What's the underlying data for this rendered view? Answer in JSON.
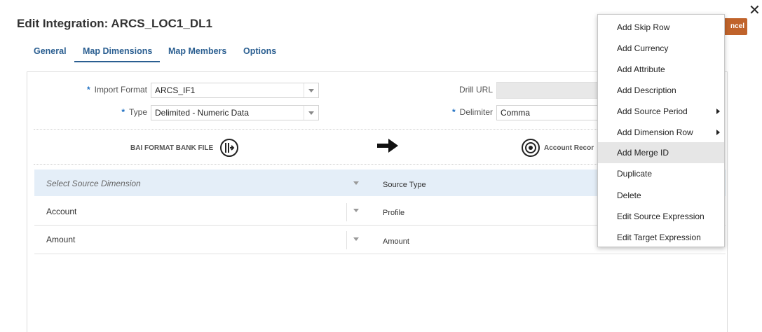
{
  "header": {
    "title": "Edit Integration: ARCS_LOC1_DL1",
    "close_symbol": "✕",
    "cancel_label": "ncel"
  },
  "tabs": [
    {
      "label": "General"
    },
    {
      "label": "Map Dimensions",
      "active": true
    },
    {
      "label": "Map Members"
    },
    {
      "label": "Options"
    }
  ],
  "form": {
    "required_mark": "*",
    "import_format_label": "Import Format",
    "import_format_value": "ARCS_IF1",
    "type_label": "Type",
    "type_value": "Delimited - Numeric Data",
    "drill_url_label": "Drill URL",
    "drill_url_value": "",
    "delimiter_label": "Delimiter",
    "delimiter_value": "Comma"
  },
  "flow": {
    "source_label": "BAI FORMAT BANK FILE",
    "target_label": "Account Recor",
    "arrow_icon": "right-arrow-icon",
    "source_icon": "import-arrow-icon",
    "target_icon": "target-icon"
  },
  "grid": {
    "header_source_placeholder": "Select Source Dimension",
    "header_source_type": "Source Type",
    "rows": [
      {
        "dimension": "Account",
        "type": "Profile"
      },
      {
        "dimension": "Amount",
        "type": "Amount"
      }
    ]
  },
  "menu": {
    "items": [
      {
        "label": "Add Skip Row"
      },
      {
        "label": "Add Currency"
      },
      {
        "label": "Add Attribute"
      },
      {
        "label": "Add Description"
      },
      {
        "label": "Add Source Period",
        "submenu": true
      },
      {
        "label": "Add Dimension Row",
        "submenu": true
      },
      {
        "label": "Add Merge ID",
        "highlighted": true
      },
      {
        "label": "Duplicate"
      },
      {
        "label": "Delete"
      },
      {
        "label": "Edit Source Expression"
      },
      {
        "label": "Edit Target Expression"
      }
    ]
  },
  "colors": {
    "accent": "#2b5f91",
    "cancel_button": "#c0632b",
    "grid_header_bg": "#e4eef8",
    "menu_highlight": "#e6e6e6"
  }
}
